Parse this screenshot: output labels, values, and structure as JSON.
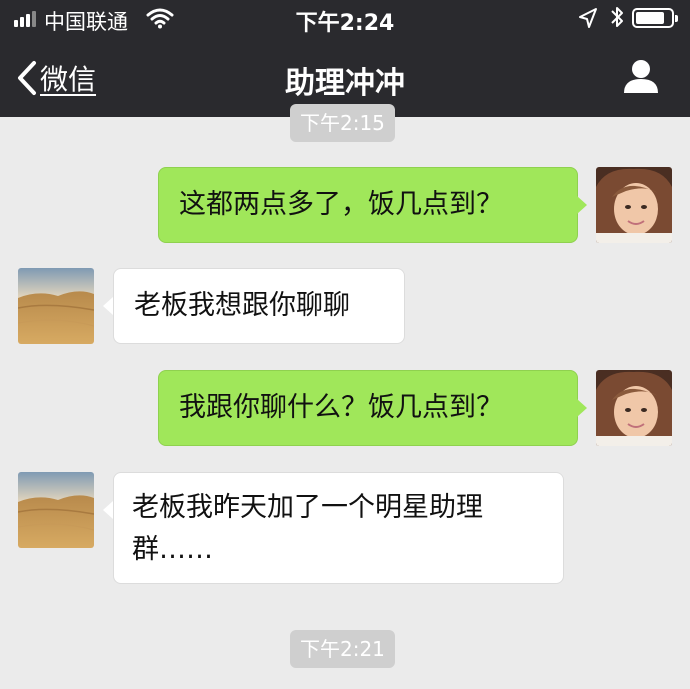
{
  "status_bar": {
    "carrier": "中国联通",
    "time": "下午2:24"
  },
  "nav": {
    "back_label": "微信",
    "title": "助理冲冲"
  },
  "messages": [
    {
      "type": "time",
      "text": "下午2:15"
    },
    {
      "type": "outgoing",
      "text": "这都两点多了，饭几点到？",
      "avatar": "girl-avatar"
    },
    {
      "type": "incoming",
      "text": "老板我想跟你聊聊",
      "avatar": "desert-avatar"
    },
    {
      "type": "outgoing",
      "text": "我跟你聊什么？饭几点到？",
      "avatar": "girl-avatar"
    },
    {
      "type": "incoming",
      "text": "老板我昨天加了一个明星助理群……",
      "avatar": "desert-avatar"
    },
    {
      "type": "time",
      "text": "下午2:21"
    }
  ],
  "colors": {
    "nav_bg": "#2a2a2e",
    "chat_bg": "#ebebeb",
    "outgoing_bubble": "#a0e75a",
    "incoming_bubble": "#ffffff"
  }
}
